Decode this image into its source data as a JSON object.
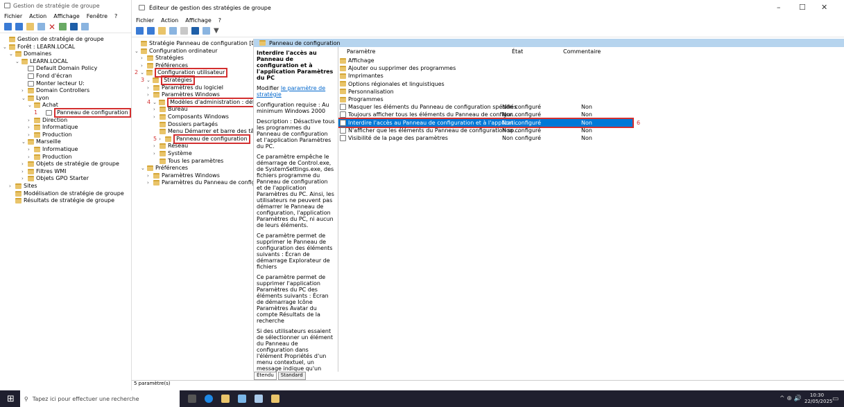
{
  "back_window": {
    "title": "Gestion de stratégie de groupe",
    "menu": [
      "Fichier",
      "Action",
      "Affichage",
      "Fenêtre",
      "?"
    ],
    "tree": [
      {
        "label": "Gestion de stratégie de groupe",
        "level": 0
      },
      {
        "label": "Forêt : LEARN.LOCAL",
        "level": 0,
        "caret": "v"
      },
      {
        "label": "Domaines",
        "level": 1,
        "caret": "v"
      },
      {
        "label": "LEARN.LOCAL",
        "level": 2,
        "caret": "v"
      },
      {
        "label": "Default Domain Policy",
        "level": 3
      },
      {
        "label": "Fond d'écran",
        "level": 3
      },
      {
        "label": "Monter lecteur U:",
        "level": 3
      },
      {
        "label": "Domain Controllers",
        "level": 3,
        "caret": ">"
      },
      {
        "label": "Lyon",
        "level": 3,
        "caret": "v"
      },
      {
        "label": "Achat",
        "level": 4,
        "caret": "v"
      },
      {
        "label": "Panneau de configuration",
        "level": 5,
        "selected": true,
        "marker": "1"
      },
      {
        "label": "Direction",
        "level": 4,
        "caret": ">"
      },
      {
        "label": "Informatique",
        "level": 4,
        "caret": ">"
      },
      {
        "label": "Production",
        "level": 4,
        "caret": ">"
      },
      {
        "label": "Marseille",
        "level": 3,
        "caret": "v"
      },
      {
        "label": "Informatique",
        "level": 4,
        "caret": ">"
      },
      {
        "label": "Production",
        "level": 4,
        "caret": ">"
      },
      {
        "label": "Objets de stratégie de groupe",
        "level": 3,
        "caret": ">"
      },
      {
        "label": "Filtres WMI",
        "level": 3,
        "caret": ">"
      },
      {
        "label": "Objets GPO Starter",
        "level": 3,
        "caret": ">"
      },
      {
        "label": "Sites",
        "level": 1,
        "caret": ">"
      },
      {
        "label": "Modélisation de stratégie de groupe",
        "level": 1
      },
      {
        "label": "Résultats de stratégie de groupe",
        "level": 1
      }
    ]
  },
  "front_window": {
    "title": "Éditeur de gestion des stratégies de groupe",
    "menu": [
      "Fichier",
      "Action",
      "Affichage",
      "?"
    ],
    "tree": [
      {
        "label": "Stratégie Panneau de configuration [DC1.LEA",
        "level": 0
      },
      {
        "label": "Configuration ordinateur",
        "level": 0,
        "caret": "v"
      },
      {
        "label": "Stratégies",
        "level": 1,
        "caret": ">"
      },
      {
        "label": "Préférences",
        "level": 1,
        "caret": ">"
      },
      {
        "label": "Configuration utilisateur",
        "level": 0,
        "caret": "v",
        "selected": true,
        "marker": "2"
      },
      {
        "label": "Stratégies",
        "level": 1,
        "caret": "v",
        "selected": true,
        "marker": "3"
      },
      {
        "label": "Paramètres du logiciel",
        "level": 2,
        "caret": ">"
      },
      {
        "label": "Paramètres Windows",
        "level": 2,
        "caret": ">"
      },
      {
        "label": "Modèles d'administration : définit",
        "level": 2,
        "caret": "v",
        "selected": true,
        "marker": "4"
      },
      {
        "label": "Bureau",
        "level": 3,
        "caret": ">"
      },
      {
        "label": "Composants Windows",
        "level": 3,
        "caret": ">"
      },
      {
        "label": "Dossiers partagés",
        "level": 3
      },
      {
        "label": "Menu Démarrer et barre des tâ",
        "level": 3
      },
      {
        "label": "Panneau de configuration",
        "level": 3,
        "caret": ">",
        "selected": true,
        "marker": "5"
      },
      {
        "label": "Réseau",
        "level": 3,
        "caret": ">"
      },
      {
        "label": "Système",
        "level": 3,
        "caret": ">"
      },
      {
        "label": "Tous les paramètres",
        "level": 3
      },
      {
        "label": "Préférences",
        "level": 1,
        "caret": "v"
      },
      {
        "label": "Paramètres Windows",
        "level": 2,
        "caret": ">"
      },
      {
        "label": "Paramètres du Panneau de config",
        "level": 2,
        "caret": ">"
      }
    ],
    "panel_header": "Panneau de configuration",
    "description": {
      "title": "Interdire l'accès au Panneau de configuration et à l'application Paramètres du PC",
      "modify_prefix": "Modifier ",
      "modify_link": "le paramètre de stratégie",
      "requirements": "Configuration requise : Au minimum Windows 2000",
      "paragraphs": [
        "Description : Désactive tous les programmes du Panneau de configuration et l'application Paramètres du PC.",
        "Ce paramètre empêche le démarrage de Control.exe, de SystemSettings.exe, des fichiers programme du Panneau de configuration et de l'application Paramètres du PC. Ainsi, les utilisateurs ne peuvent pas démarrer le Panneau de configuration, l'application Paramètres du PC, ni aucun de leurs éléments.",
        "Ce paramètre permet de supprimer le Panneau de configuration des éléments suivants : Écran de démarrage Explorateur de fichiers",
        "Ce paramètre permet de supprimer l'application Paramètres du PC des éléments suivants : Écran de démarrage Icône Paramètres Avatar du compte Résultats de la recherche",
        "Si des utilisateurs essaient de sélectionner un élément du Panneau de configuration dans l'élément Propriétés d'un menu contextuel, un message indique qu'un paramètre bloque cette"
      ]
    },
    "columns": {
      "setting": "Paramètre",
      "state": "État",
      "comment": "Commentaire"
    },
    "rows": [
      {
        "label": "Affichage",
        "type": "folder",
        "state": "",
        "comment": ""
      },
      {
        "label": "Ajouter ou supprimer des programmes",
        "type": "folder",
        "state": "",
        "comment": ""
      },
      {
        "label": "Imprimantes",
        "type": "folder",
        "state": "",
        "comment": ""
      },
      {
        "label": "Options régionales et linguistiques",
        "type": "folder",
        "state": "",
        "comment": ""
      },
      {
        "label": "Personnalisation",
        "type": "folder",
        "state": "",
        "comment": ""
      },
      {
        "label": "Programmes",
        "type": "folder",
        "state": "",
        "comment": ""
      },
      {
        "label": "Masquer les éléments du Panneau de configuration spécifiés",
        "type": "setting",
        "state": "Non configuré",
        "comment": "Non"
      },
      {
        "label": "Toujours afficher tous les éléments du Panneau de configur...",
        "type": "setting",
        "state": "Non configuré",
        "comment": "Non"
      },
      {
        "label": "Interdire l'accès au Panneau de configuration et à l'applicati...",
        "type": "setting",
        "state": "Non configuré",
        "comment": "Non",
        "selected": true,
        "marker": "6"
      },
      {
        "label": "N'afficher que les éléments du Panneau de configuration sp...",
        "type": "setting",
        "state": "Non configuré",
        "comment": "Non"
      },
      {
        "label": "Visibilité de la page des paramètres",
        "type": "setting",
        "state": "Non configuré",
        "comment": "Non"
      }
    ],
    "tabs": [
      "Étendu",
      "Standard"
    ],
    "status": "5 paramètre(s)"
  },
  "taskbar": {
    "search_placeholder": "Tapez ici pour effectuer une recherche",
    "time": "10:30",
    "date": "22/05/2025"
  },
  "colors": {
    "accent": "#0078d7",
    "panel_header": "#b6d4ee",
    "red": "#d32f2f"
  }
}
